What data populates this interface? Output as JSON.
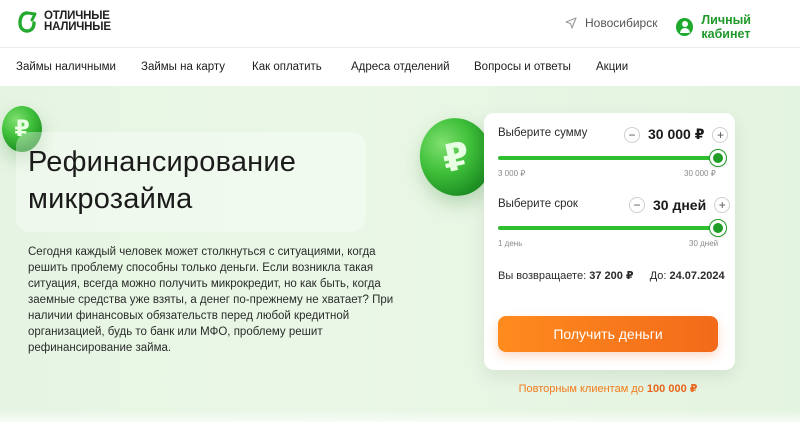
{
  "header": {
    "logo_line1": "ОТЛИЧНЫЕ",
    "logo_line2": "НАЛИЧНЫЕ",
    "city": "Новосибирск",
    "cabinet_label": "Личный кабинет"
  },
  "nav": {
    "items": [
      "Займы наличными",
      "Займы на карту",
      "Как оплатить",
      "Адреса отделений",
      "Вопросы и ответы",
      "Акции"
    ]
  },
  "hero": {
    "title_line1": "Рефинансирование",
    "title_line2": "микрозайма",
    "description": "Сегодня каждый человек может столкнуться с ситуациями, когда решить проблему способны только деньги. Если возникла такая ситуация, всегда можно получить микрокредит, но как быть, когда заемные средства уже взяты, а денег по-прежнему не хватает? При наличии финансовых обязательств перед любой кредитной организацией, будь то банк или МФО, проблему решит рефинансирование займа.",
    "coin_symbol": "₽"
  },
  "calculator": {
    "amount": {
      "label": "Выберите сумму",
      "value": "30 000 ₽",
      "min_label": "3 000 ₽",
      "max_label": "30 000 ₽",
      "slider_fraction": 1.0
    },
    "term": {
      "label": "Выберите срок",
      "value": "30 дней",
      "min_label": "1 день",
      "max_label": "30 дней",
      "slider_fraction": 1.0
    },
    "minus": "−",
    "plus": "+",
    "return_label": "Вы возвращаете:",
    "return_value": "37 200 ₽",
    "until_label": "До:",
    "until_value": "24.07.2024",
    "cta_label": "Получить деньги",
    "repeat_text": "Повторным клиентам до",
    "repeat_amount": "100 000 ₽"
  },
  "colors": {
    "brand_green": "#1f9d26",
    "slider_green": "#2fbf2f",
    "cta_orange": "#f26a1a",
    "hero_bg": "#e6f5e3"
  }
}
